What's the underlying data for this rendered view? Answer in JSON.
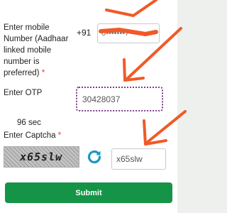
{
  "form": {
    "mobile": {
      "label": "Enter mobile Number (Aadhaar linked mobile number is preferred)",
      "required_mark": "*",
      "prefix": "+91",
      "value": "8•••••••7"
    },
    "otp": {
      "label": "Enter OTP",
      "value": "30428037"
    },
    "timer": "96 sec",
    "captcha": {
      "label": "Enter Captcha",
      "required_mark": "*",
      "image_text": "x65slw",
      "value": "x65slw",
      "refresh_icon": "refresh-icon"
    },
    "submit_label": "Submit"
  },
  "colors": {
    "submit_bg": "#159447",
    "otp_focus_border": "#7b3f8c",
    "required": "#e53935",
    "refresh": "#1a97c4",
    "annotation": "#f05a28"
  }
}
